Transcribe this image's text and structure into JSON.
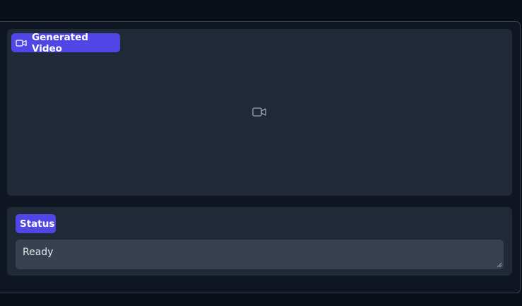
{
  "video": {
    "label": "Generated Video",
    "label_icon": "video-camera-icon",
    "placeholder_icon": "video-camera-icon"
  },
  "status": {
    "label": "Status",
    "value": "Ready"
  },
  "colors": {
    "background": "#0b0f19",
    "block": "#1f2937",
    "accent": "#4f46e5",
    "field": "#374151"
  }
}
